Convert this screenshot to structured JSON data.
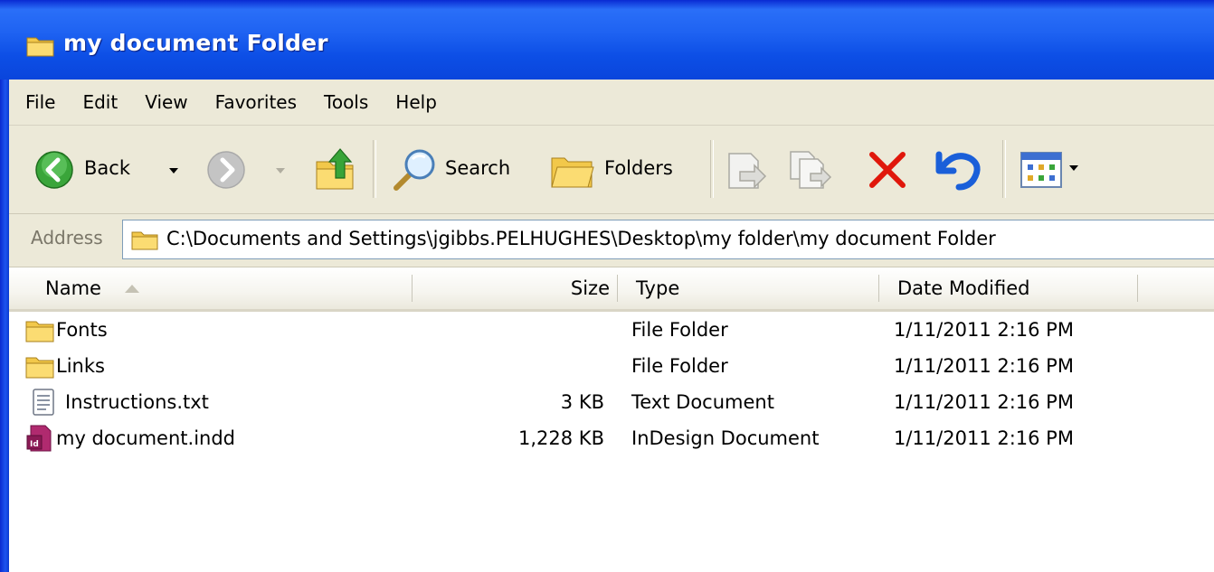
{
  "window": {
    "title": "my document Folder"
  },
  "menu": [
    "File",
    "Edit",
    "View",
    "Favorites",
    "Tools",
    "Help"
  ],
  "toolbar": {
    "back_label": "Back",
    "search_label": "Search",
    "folders_label": "Folders"
  },
  "address": {
    "label": "Address",
    "path": "C:\\Documents and Settings\\jgibbs.PELHUGHES\\Desktop\\my folder\\my document Folder"
  },
  "columns": {
    "name": "Name",
    "size": "Size",
    "type": "Type",
    "date": "Date Modified"
  },
  "files": [
    {
      "name": "Fonts",
      "size": "",
      "type": "File Folder",
      "date": "1/11/2011 2:16 PM",
      "icon": "folder-icon"
    },
    {
      "name": "Links",
      "size": "",
      "type": "File Folder",
      "date": "1/11/2011 2:16 PM",
      "icon": "folder-icon"
    },
    {
      "name": "Instructions.txt",
      "size": "3 KB",
      "type": "Text Document",
      "date": "1/11/2011 2:16 PM",
      "icon": "text-file-icon"
    },
    {
      "name": "my document.indd",
      "size": "1,228 KB",
      "type": "InDesign Document",
      "date": "1/11/2011 2:16 PM",
      "icon": "indesign-file-icon"
    }
  ],
  "colors": {
    "titlebar": "#1f63f2",
    "chrome": "#ece9d8",
    "delete_red": "#e0170b",
    "undo_blue": "#1a5fd9",
    "back_green": "#3aa53a"
  }
}
